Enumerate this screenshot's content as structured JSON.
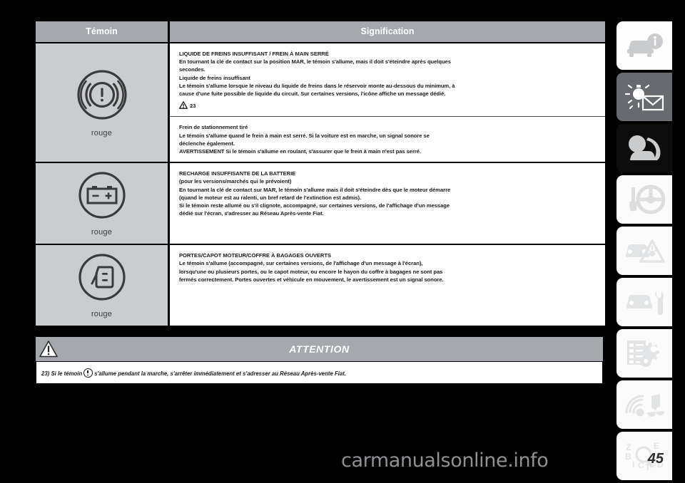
{
  "table": {
    "headers": {
      "left": "Témoin",
      "right": "Signification"
    },
    "rows": [
      {
        "icon_name": "brake-warning-lamp-icon",
        "lamp_color_label": "rouge",
        "blocks": [
          {
            "lines": [
              "LIQUIDE DE FREINS INSUFFISANT / FREIN À MAIN SERRÉ",
              "En tournant la clé de contact sur la position MAR, le témoin s'allume, mais il doit s'éteindre après quelques",
              "secondes.",
              "Liquide de freins insuffisant",
              "Le témoin s'allume lorsque le niveau du liquide de freins dans le réservoir monte au-dessous du minimum, à",
              "cause d'une fuite possible de liquide du circuit. Sur certaines versions, l'icône affiche un message dédié."
            ],
            "ref": "23"
          },
          {
            "lines": [
              "Frein de stationnement tiré",
              "Le témoin s'allume quand le frein à main est serré. Si la voiture est en marche, un signal sonore se",
              "déclenche également.",
              "AVERTISSEMENT Si le témoin s'allume en roulant, s'assurer que le frein à main n'est pas serré."
            ]
          }
        ]
      },
      {
        "icon_name": "battery-charge-lamp-icon",
        "lamp_color_label": "rouge",
        "blocks": [
          {
            "lines": [
              "RECHARGE INSUFFISANTE DE LA BATTERIE",
              "(pour les versions/marchés qui le prévoient)",
              "En tournant la clé de contact sur MAR, le témoin s'allume mais il doit s'éteindre dès que le moteur démarre",
              "(quand le moteur est au ralenti, un bref retard de l'extinction est admis).",
              "Si le témoin reste allumé ou s'il clignote, accompagné, sur certaines versions, de l'affichage d'un message",
              "dédié sur l'écran, s'adresser au Réseau Après-vente Fiat."
            ]
          }
        ]
      },
      {
        "icon_name": "doors-open-lamp-icon",
        "lamp_color_label": "rouge",
        "blocks": [
          {
            "lines": [
              "PORTES/CAPOT MOTEUR/COFFRE À BAGAGES OUVERTS",
              "Le témoin s'allume (accompagné, sur certaines versions, de l'affichage d'un message à l'écran),",
              "lorsqu'une ou plusieurs portes, ou le capot moteur, ou encore le hayon du coffre à bagages ne sont pas",
              "fermés correctement. Portes ouvertes et véhicule en mouvement, le avertissement est un signal sonore."
            ]
          }
        ]
      }
    ]
  },
  "attention": {
    "title": "ATTENTION",
    "icon_name": "warning-triangle-icon",
    "note_ref": "23)",
    "note_prefix": "Si le témoin",
    "note_suffix": "s'allume pendant la marche, s'arrêter immédiatement et s'adresser au Réseau Après-vente Fiat."
  },
  "sidebar": {
    "tabs": [
      {
        "icon_name": "car-info-icon",
        "label": "Connaissance du véhicule",
        "bg": "#fdfdfd",
        "fg": "#c9cbcd",
        "active": true
      },
      {
        "icon_name": "lights-message-icon",
        "label": "Connaissance du tableau de bord",
        "bg": "#676b6f",
        "fg": "#ffffff",
        "active": false
      },
      {
        "icon_name": "airbag-icon",
        "label": "Sécurité",
        "bg": "#0c0c0c",
        "fg": "#c9cbcd",
        "active": false
      },
      {
        "icon_name": "key-steering-icon",
        "label": "Démarrage et conduite",
        "bg": "#fbfbfb",
        "fg": "#dcdee0",
        "active": false
      },
      {
        "icon_name": "car-hazard-icon",
        "label": "En cas d'urgence",
        "bg": "#fbfbfb",
        "fg": "#e2e4e6",
        "active": false
      },
      {
        "icon_name": "car-wrench-icon",
        "label": "Entretien et soin",
        "bg": "#fbfbfb",
        "fg": "#e2e4e6",
        "active": false
      },
      {
        "icon_name": "specs-gears-icon",
        "label": "Caractéristiques techniques",
        "bg": "#fbfbfb",
        "fg": "#e2e4e6",
        "active": false
      },
      {
        "icon_name": "multimedia-icon",
        "label": "Multimédia",
        "bg": "#fbfbfb",
        "fg": "#e2e4e6",
        "active": false
      },
      {
        "icon_name": "index-search-icon",
        "label": "Index alphabétique",
        "bg": "#fbfbfb",
        "fg": "#e2e4e6",
        "active": false
      }
    ]
  },
  "footer": {
    "watermark": "carmanualsonline.info",
    "page_number": "45"
  }
}
